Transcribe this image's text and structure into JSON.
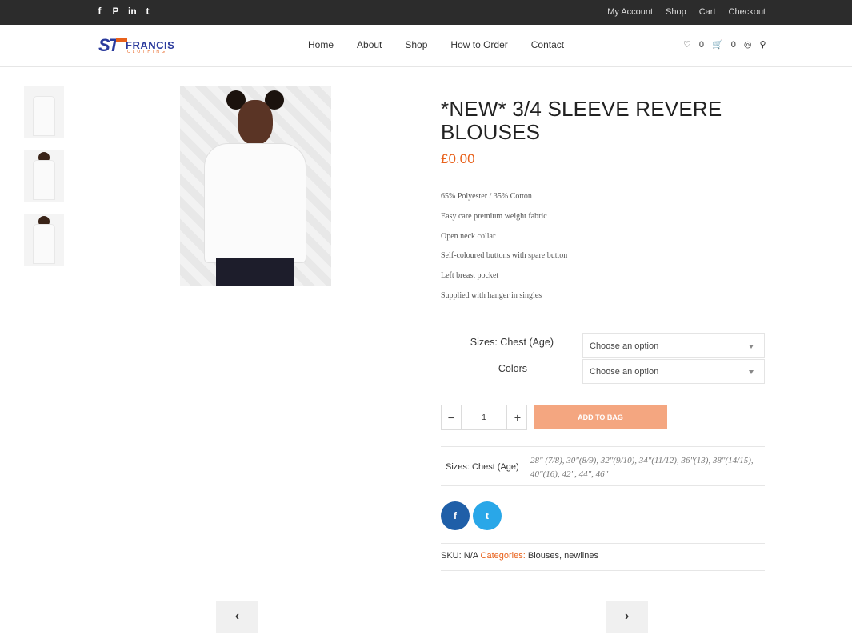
{
  "topbar": {
    "social": [
      {
        "icon": "facebook-icon",
        "glyph": "f"
      },
      {
        "icon": "pinterest-icon",
        "glyph": "P"
      },
      {
        "icon": "linkedin-icon",
        "glyph": "in"
      },
      {
        "icon": "twitter-icon",
        "glyph": "t"
      }
    ],
    "links": [
      "My Account",
      "Shop",
      "Cart",
      "Checkout"
    ]
  },
  "header": {
    "logo": {
      "mark": "ST",
      "name": "FRANCIS",
      "sub": "CLOTHING"
    },
    "nav": [
      "Home",
      "About",
      "Shop",
      "How to Order",
      "Contact"
    ],
    "wishlist_count": "0",
    "cart_count": "0"
  },
  "product": {
    "title": "*NEW* 3/4 SLEEVE REVERE BLOUSES",
    "price": "£0.00",
    "description": [
      "65% Polyester / 35% Cotton",
      "Easy care premium weight fabric",
      "Open neck collar",
      "Self-coloured buttons with spare button",
      "Left breast pocket",
      "Supplied with hanger in singles"
    ],
    "variations": {
      "size_label": "Sizes: Chest (Age)",
      "size_selected": "Choose an option",
      "color_label": "Colors",
      "color_selected": "Choose an option"
    },
    "quantity": "1",
    "add_to_bag": "ADD TO BAG",
    "attributes": {
      "label": "Sizes: Chest (Age)",
      "value": "28\" (7/8), 30\"(8/9), 32\"(9/10), 34\"(11/12), 36\"(13), 38\"(14/15), 40\"(16), 42\", 44\", 46\""
    },
    "meta": {
      "sku_label": "SKU:",
      "sku": "N/A",
      "categories_label": "Categories:",
      "categories": [
        "Blouses",
        "newlines"
      ]
    }
  },
  "colors": {
    "accent": "#e8611b",
    "brand": "#2a3a9c",
    "topbar": "#2c2c2c",
    "add_button": "#f4a680"
  }
}
